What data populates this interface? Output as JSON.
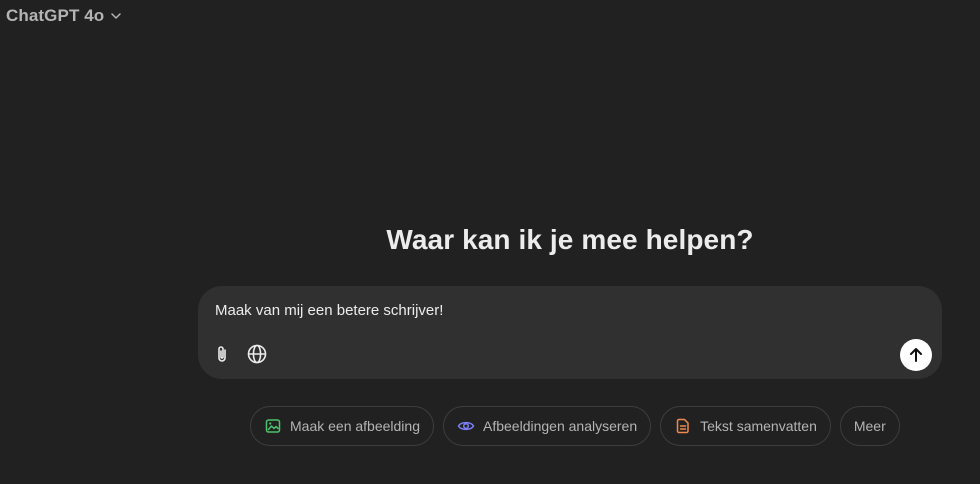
{
  "header": {
    "model_name": "ChatGPT 4o"
  },
  "main": {
    "headline": "Waar kan ik je mee helpen?"
  },
  "composer": {
    "input_value": "Maak van mij een betere schrijver!",
    "icons": {
      "attach": "paperclip-icon",
      "web": "globe-icon",
      "send": "arrow-up-icon"
    }
  },
  "suggestions": [
    {
      "label": "Maak een afbeelding",
      "icon": "image-icon",
      "color": "#4ec26b"
    },
    {
      "label": "Afbeeldingen analyseren",
      "icon": "eye-icon",
      "color": "#7b7ff5"
    },
    {
      "label": "Tekst samenvatten",
      "icon": "document-icon",
      "color": "#ef8a4c"
    },
    {
      "label": "Meer",
      "icon": "",
      "color": ""
    }
  ],
  "colors": {
    "background": "#212121",
    "composer": "#303030",
    "send_button": "#ffffff"
  }
}
